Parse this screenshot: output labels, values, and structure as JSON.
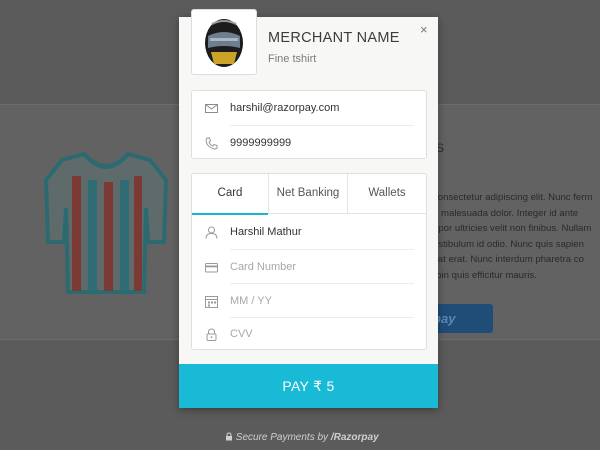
{
  "background": {
    "title": "S",
    "paragraph_lines": [
      "consectetur adipiscing elit. Nunc ferm",
      "d malesuada dolor. Integer id ante",
      "npor ultricies velit non finibus. Nullam",
      "estibulum id odio. Nunc quis sapien",
      "sat erat. Nunc interdum pharetra co",
      "roin quis efficitur mauris."
    ],
    "button_label": "rpay",
    "shirt_colors": {
      "outline": "#2c6a72",
      "stripe_red": "#7b3a34",
      "stripe_teal": "#2f6d74"
    }
  },
  "modal": {
    "merchant_name": "MERCHANT NAME",
    "description": "Fine tshirt",
    "close": "×",
    "contact": {
      "email": "harshil@razorpay.com",
      "phone": "9999999999",
      "email_icon": "mail-icon",
      "phone_icon": "phone-icon"
    },
    "tabs": [
      {
        "label": "Card",
        "active": true
      },
      {
        "label": "Net Banking",
        "active": false
      },
      {
        "label": "Wallets",
        "active": false
      }
    ],
    "card_form": {
      "name_value": "Harshil Mathur",
      "card_number_placeholder": "Card Number",
      "expiry_placeholder": "MM / YY",
      "cvv_placeholder": "CVV"
    },
    "pay_button": "PAY ₹ 5"
  },
  "footer": {
    "secure_text": "Secure Payments by",
    "brand": "Razorpay"
  },
  "colors": {
    "accent": "#19bad6",
    "overlay": "#5b5b5b"
  }
}
